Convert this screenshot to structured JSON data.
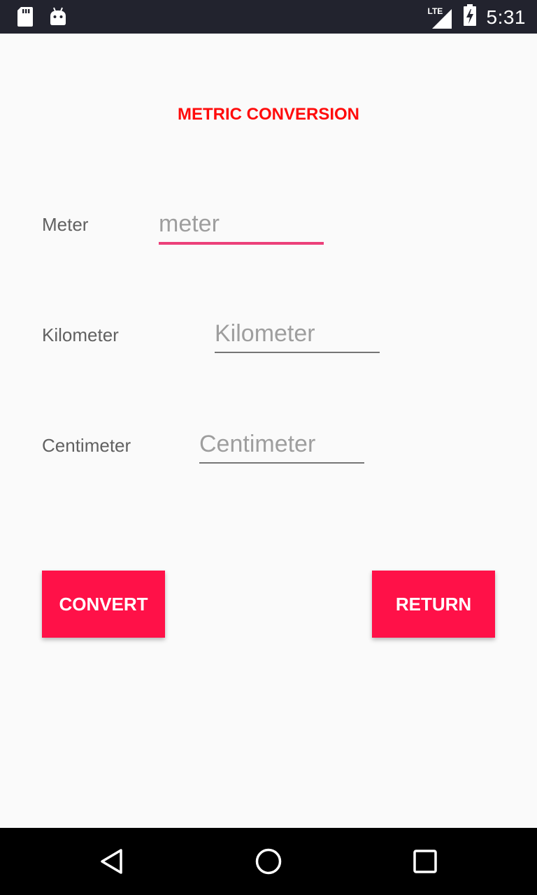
{
  "status_bar": {
    "time": "5:31",
    "network": "LTE",
    "icons": [
      "sd-card-icon",
      "android-icon",
      "signal-icon",
      "battery-charging-icon"
    ]
  },
  "app": {
    "title": "METRIC CONVERSION",
    "fields": [
      {
        "label": "Meter",
        "placeholder": "meter",
        "value": ""
      },
      {
        "label": "Kilometer",
        "placeholder": "Kilometer",
        "value": ""
      },
      {
        "label": "Centimeter",
        "placeholder": "Centimeter",
        "value": ""
      }
    ],
    "buttons": {
      "convert": "CONVERT",
      "return": "RETURN"
    }
  },
  "colors": {
    "title": "#ff0b0b",
    "button": "#ff1148",
    "focus_underline": "#ec407a",
    "status_bar": "#22232e",
    "nav_bar": "#000000"
  },
  "nav_bar": {
    "icons": [
      "back-icon",
      "home-icon",
      "recents-icon"
    ]
  }
}
